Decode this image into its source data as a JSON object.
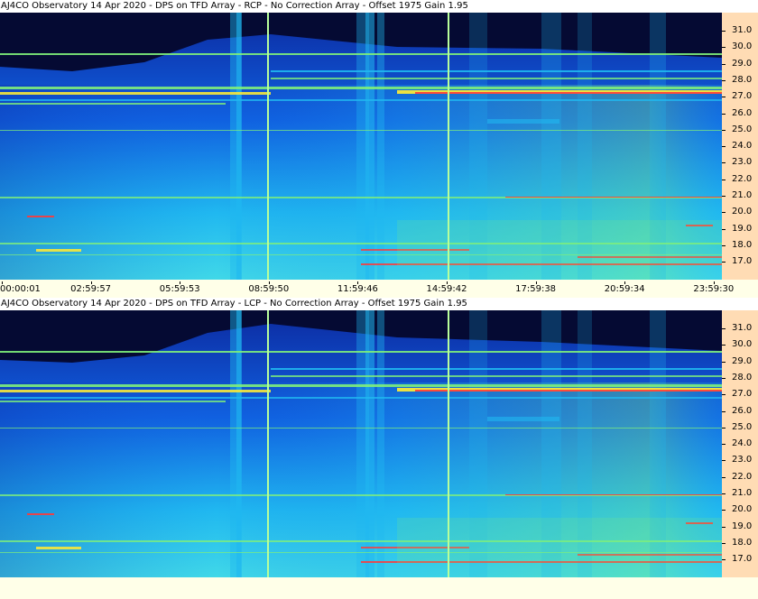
{
  "panels": [
    {
      "id": "rcp",
      "title": "AJ4CO Observatory 14 Apr 2020 - DPS on TFD Array  - RCP  -  No Correction Array  -  Offset 1975  Gain 1.95",
      "freq_labels": [
        "31.0",
        "30.0",
        "29.0",
        "28.0",
        "27.0",
        "26.0",
        "25.0",
        "24.0",
        "23.0",
        "22.0",
        "21.0",
        "20.0",
        "19.0",
        "18.0",
        "17.0"
      ],
      "time_labels": [
        "00:00:01",
        "02:59:57",
        "05:59:53",
        "08:59:50",
        "11:59:46",
        "14:59:42",
        "17:59:38",
        "20:59:34",
        "23:59:30"
      ]
    },
    {
      "id": "lcp",
      "title": "AJ4CO Observatory 14 Apr 2020 - DPS on TFD Array  - LCP  -  No Correction Array  -  Offset 1975  Gain 1.95",
      "freq_labels": [
        "31.0",
        "30.0",
        "29.0",
        "28.0",
        "27.0",
        "26.0",
        "25.0",
        "24.0",
        "23.0",
        "22.0",
        "21.0",
        "20.0",
        "19.0",
        "18.0",
        "17.0"
      ],
      "time_labels": []
    }
  ],
  "colors": {
    "night": "#050a33",
    "deep_blue": "#0c2aa0",
    "blue": "#1060e0",
    "cyan": "#20b8f0",
    "green": "#7ff07a",
    "yellow": "#f8e83a",
    "red": "#ff3a3a",
    "marker": "#b8ff9a",
    "axis_bg": "#ffdcb4",
    "strip_bg": "#ffffe8"
  }
}
